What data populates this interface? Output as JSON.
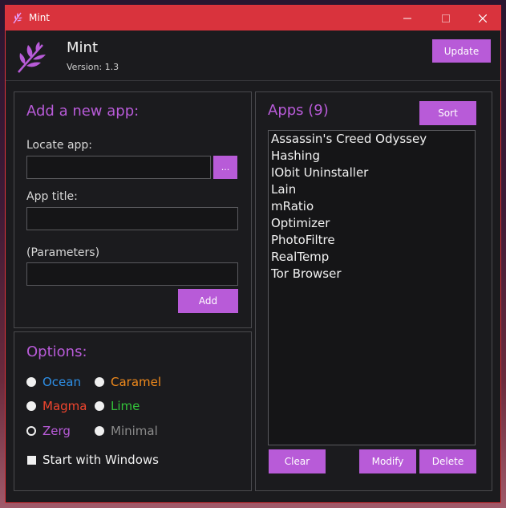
{
  "window": {
    "title": "Mint"
  },
  "header": {
    "app_name": "Mint",
    "version": "Version: 1.3",
    "update_label": "Update"
  },
  "add_panel": {
    "title": "Add a new app:",
    "locate_label": "Locate app:",
    "locate_value": "",
    "browse_label": "...",
    "app_title_label": "App title:",
    "app_title_value": "",
    "params_label": "(Parameters)",
    "params_value": "",
    "add_label": "Add"
  },
  "options": {
    "title": "Options:",
    "themes": [
      {
        "label": "Ocean",
        "color": "#2e8fe6",
        "selected": false
      },
      {
        "label": "Caramel",
        "color": "#f08a1c",
        "selected": false
      },
      {
        "label": "Magma",
        "color": "#f0452e",
        "selected": false
      },
      {
        "label": "Lime",
        "color": "#33c23a",
        "selected": false
      },
      {
        "label": "Zerg",
        "color": "#b85bd8",
        "selected": true
      },
      {
        "label": "Minimal",
        "color": "#8c8c8c",
        "selected": false
      }
    ],
    "start_with_windows_label": "Start with Windows",
    "start_with_windows_checked": false
  },
  "apps_panel": {
    "title": "Apps (9)",
    "sort_label": "Sort",
    "apps": [
      "Assassin's Creed Odyssey",
      "Hashing",
      "IObit Uninstaller",
      "Lain",
      "mRatio",
      "Optimizer",
      "PhotoFiltre",
      "RealTemp",
      "Tor Browser"
    ],
    "clear_label": "Clear",
    "modify_label": "Modify",
    "delete_label": "Delete"
  },
  "colors": {
    "accent": "#b85bd8",
    "titlebar": "#d9333d",
    "background": "#1b1b1e"
  }
}
